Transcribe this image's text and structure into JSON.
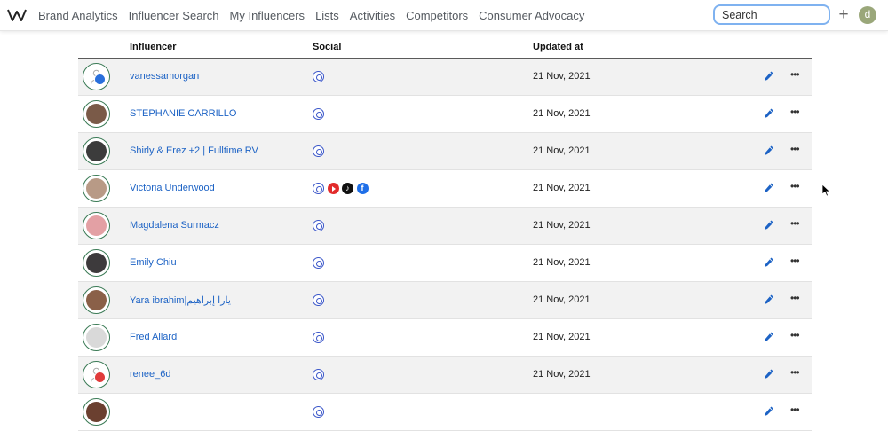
{
  "nav": {
    "items": [
      "Brand Analytics",
      "Influencer Search",
      "My Influencers",
      "Lists",
      "Activities",
      "Competitors",
      "Consumer Advocacy"
    ],
    "search_placeholder": "Search",
    "user_initial": "d"
  },
  "table": {
    "headers": {
      "influencer": "Influencer",
      "social": "Social",
      "updated": "Updated at"
    },
    "rows": [
      {
        "name": "vanessamorgan",
        "socials": [
          "instagram"
        ],
        "updated": "21 Nov, 2021",
        "avatar": "placeholder",
        "badge": "sync",
        "avatar_color": "#ffffff"
      },
      {
        "name": "STEPHANIE CARRILLO",
        "socials": [
          "instagram"
        ],
        "updated": "21 Nov, 2021",
        "avatar": "photo",
        "avatar_color": "#7a5a48"
      },
      {
        "name": "Shirly & Erez +2 | Fulltime RV",
        "socials": [
          "instagram"
        ],
        "updated": "21 Nov, 2021",
        "avatar": "logo",
        "avatar_color": "#3c3c3c"
      },
      {
        "name": "Victoria Underwood",
        "socials": [
          "instagram",
          "youtube",
          "tiktok",
          "facebook"
        ],
        "updated": "21 Nov, 2021",
        "avatar": "photo",
        "avatar_color": "#b89a86"
      },
      {
        "name": "Magdalena Surmacz",
        "socials": [
          "instagram"
        ],
        "updated": "21 Nov, 2021",
        "avatar": "photo",
        "avatar_color": "#e3a0a4"
      },
      {
        "name": "Emily Chiu",
        "socials": [
          "instagram"
        ],
        "updated": "21 Nov, 2021",
        "avatar": "photo",
        "avatar_color": "#3d3a3c"
      },
      {
        "name": "Yara ibrahim|يارا إبراهيم",
        "socials": [
          "instagram"
        ],
        "updated": "21 Nov, 2021",
        "avatar": "photo",
        "avatar_color": "#8a6048"
      },
      {
        "name": "Fred Allard",
        "socials": [
          "instagram"
        ],
        "updated": "21 Nov, 2021",
        "avatar": "logo",
        "avatar_color": "#d9d9d9"
      },
      {
        "name": "renee_6d",
        "socials": [
          "instagram"
        ],
        "updated": "21 Nov, 2021",
        "avatar": "placeholder",
        "badge": "error",
        "avatar_color": "#ffffff"
      },
      {
        "name": "",
        "socials": [
          "instagram"
        ],
        "updated": "",
        "avatar": "photo",
        "avatar_color": "#6b4030"
      }
    ]
  },
  "colors": {
    "link": "#1d63c5",
    "accent_blue": "#3a56c9",
    "badge_sync": "#2a6fdb",
    "badge_error": "#e03b3b"
  },
  "icons": {
    "logo": "brand-logo-icon",
    "add": "plus-icon",
    "edit": "pencil-icon",
    "more": "ellipsis-icon"
  }
}
